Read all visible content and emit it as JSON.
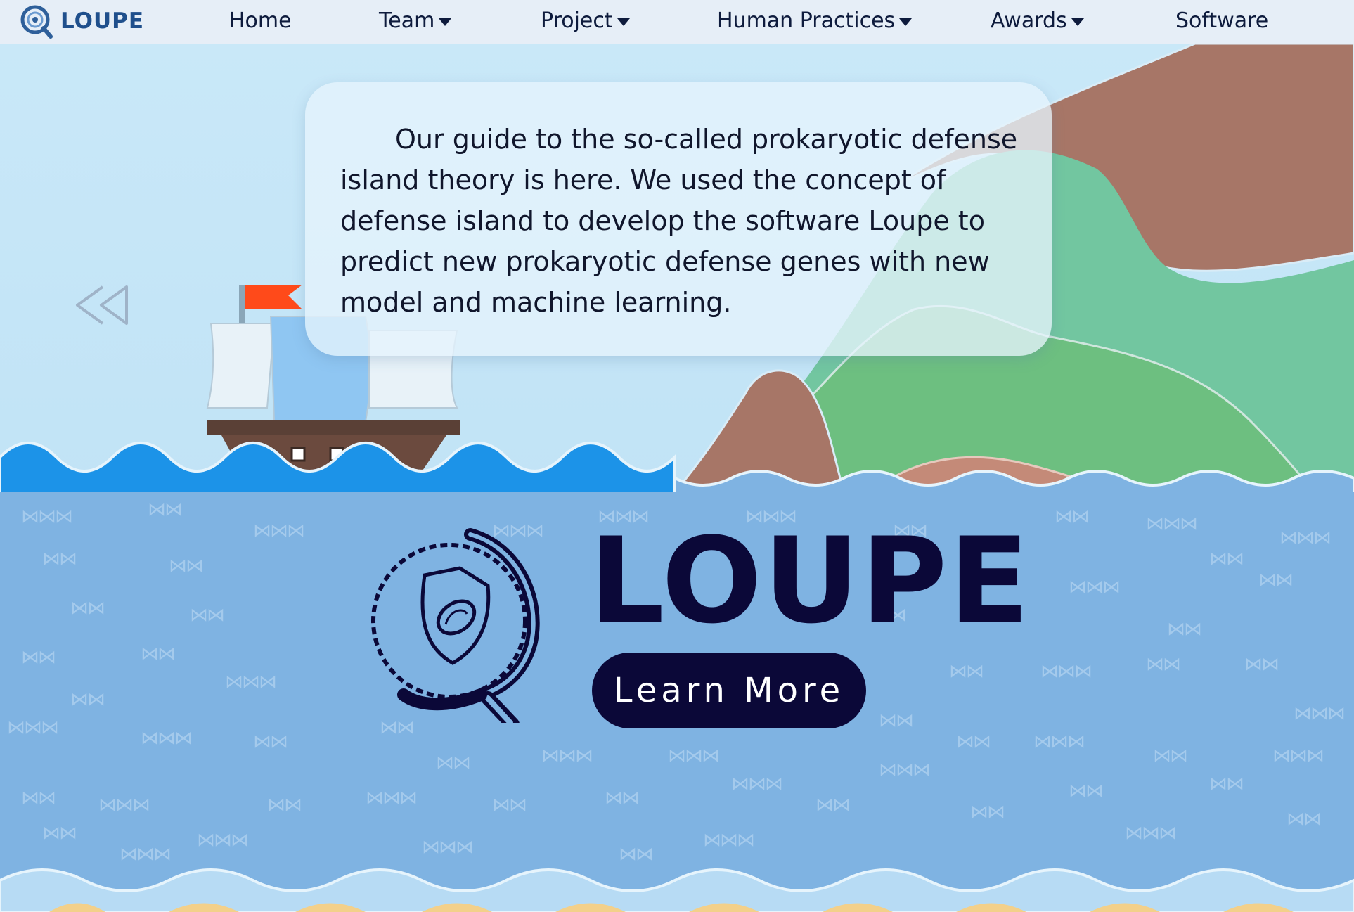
{
  "nav": {
    "brand": "LOUPE",
    "items": [
      {
        "label": "Home",
        "dropdown": false
      },
      {
        "label": "Team",
        "dropdown": true
      },
      {
        "label": "Project",
        "dropdown": true
      },
      {
        "label": "Human Practices",
        "dropdown": true
      },
      {
        "label": "Awards",
        "dropdown": true
      },
      {
        "label": "Software",
        "dropdown": false
      }
    ]
  },
  "hero": {
    "description": "Our guide to the so-called prokaryotic defense island theory is here. We used the concept of defense island to develop the software Loupe to predict new prokaryotic defense genes with new model and machine learning.",
    "prev_icon": "double-chevron-left-icon"
  },
  "logo": {
    "title": "LOUPE",
    "button_label": "Learn More"
  },
  "colors": {
    "nav_bg": "#e6eef7",
    "sky": "#c9e8f8",
    "sea": "#7fb3e2",
    "wave_blue": "#1c93e8",
    "mountain_brown": "#a77667",
    "mountain_green": "#6fc289",
    "dark_navy": "#0b0838"
  }
}
